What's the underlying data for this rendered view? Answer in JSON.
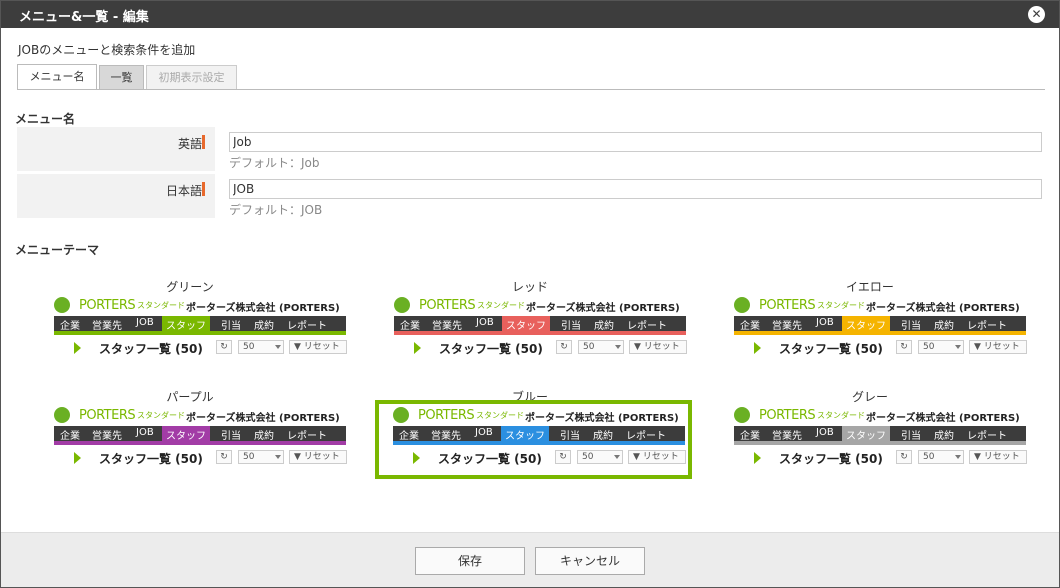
{
  "dialog": {
    "title": "メニュー&一覧 - 編集",
    "close_glyph": "✕",
    "subtitle": "JOBのメニューと検索条件を追加"
  },
  "tabs": [
    {
      "label": "メニュー名",
      "state": "active"
    },
    {
      "label": "一覧",
      "state": "normal"
    },
    {
      "label": "初期表示設定",
      "state": "disabled"
    }
  ],
  "menu_name": {
    "section_label": "メニュー名",
    "fields": [
      {
        "label": "英語",
        "value": "Job",
        "hint": "デフォルト：Job"
      },
      {
        "label": "日本語",
        "value": "JOB",
        "hint": "デフォルト：JOB"
      }
    ]
  },
  "theme": {
    "section_label": "メニューテーマ",
    "logo_text": "PORTERS",
    "logo_edition": "スタンダード",
    "company": "ポーターズ株式会社 (PORTERS)",
    "nav": [
      "企業",
      "営業先",
      "JOB",
      "スタッフ",
      "引当",
      "成約",
      "レポート"
    ],
    "active_nav": "スタッフ",
    "list_title": "スタッフ一覧 (50)",
    "refresh_glyph": "↻",
    "page_size": "50",
    "reset_label": "▼ リセット",
    "options": [
      {
        "name": "グリーン",
        "color": "#7ab800",
        "selected": false
      },
      {
        "name": "レッド",
        "color": "#e8605c",
        "selected": false
      },
      {
        "name": "イエロー",
        "color": "#f5b400",
        "selected": false
      },
      {
        "name": "パープル",
        "color": "#a23ca6",
        "selected": false
      },
      {
        "name": "ブルー",
        "color": "#2b8fe0",
        "selected": true
      },
      {
        "name": "グレー",
        "color": "#a6a6a6",
        "selected": false
      }
    ]
  },
  "footer": {
    "save_label": "保存",
    "cancel_label": "キャンセル"
  }
}
